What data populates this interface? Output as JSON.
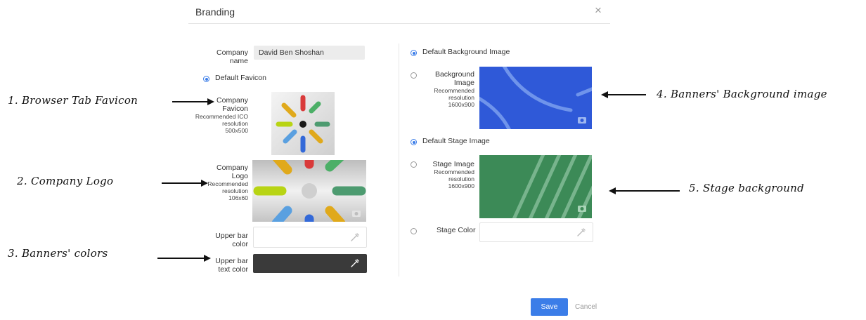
{
  "dialog": {
    "title": "Branding",
    "close_glyph": "×"
  },
  "left": {
    "company_name_label_1": "Company",
    "company_name_label_2": "name",
    "company_name_value": "David Ben Shoshan",
    "default_favicon_label": "Default Favicon",
    "favicon_label_1": "Company",
    "favicon_label_2": "Favicon",
    "favicon_rec_1": "Recommended ICO",
    "favicon_rec_2": "resolution",
    "favicon_rec_3": "500x500",
    "logo_label_1": "Company",
    "logo_label_2": "Logo",
    "logo_rec_1": "Recommended",
    "logo_rec_2": "resolution",
    "logo_rec_3": "106x60",
    "upper_bar_color_label_1": "Upper bar",
    "upper_bar_color_label_2": "color",
    "upper_bar_text_label_1": "Upper bar",
    "upper_bar_text_label_2": "text color"
  },
  "right": {
    "default_bg_label": "Default Background Image",
    "bg_label_1": "Background",
    "bg_label_2": "Image",
    "bg_rec_1": "Recommended",
    "bg_rec_2": "resolution",
    "bg_rec_3": "1600x900",
    "default_stage_label": "Default Stage Image",
    "stage_label_1": "Stage Image",
    "stage_rec_1": "Recommended",
    "stage_rec_2": "resolution",
    "stage_rec_3": "1600x900",
    "stage_color_label": "Stage Color"
  },
  "footer": {
    "save_label": "Save",
    "cancel_label": "Cancel"
  },
  "annotations": {
    "a1": "1. Browser Tab Favicon",
    "a2": "2. Company Logo",
    "a3": "3. Banners' colors",
    "a4": "4. Banners' Background image",
    "a5": "5. Stage background"
  },
  "colors": {
    "accent": "#3b7de8",
    "bg_image_blue": "#2f59d8",
    "stage_green": "#3c8a57",
    "upper_bar_text_color": "#3a3a3a"
  }
}
